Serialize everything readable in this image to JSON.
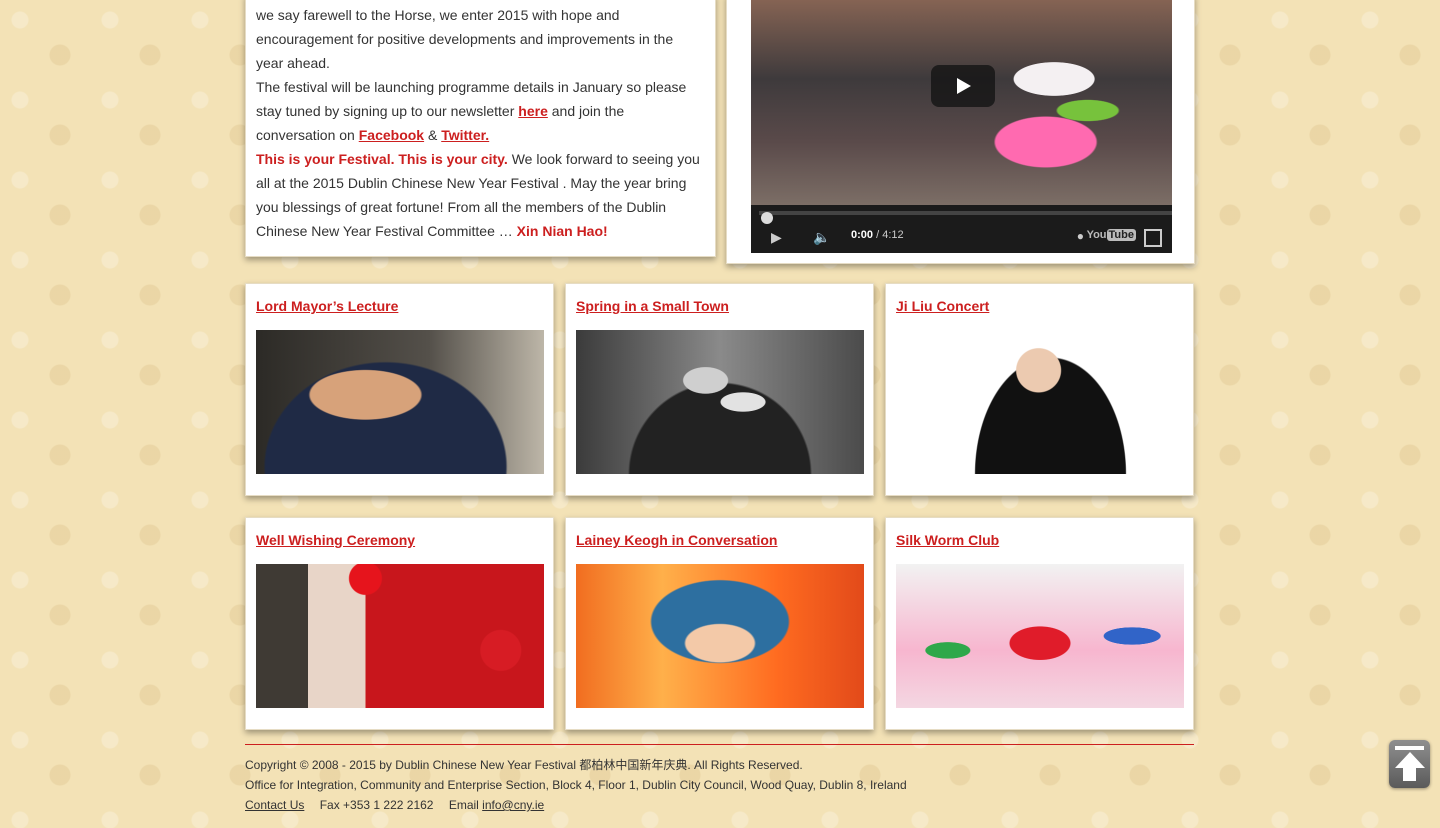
{
  "intro": {
    "line1": "we say farewell to the Horse, we enter 2015 with hope and",
    "line2": "encouragement for positive developments and improvements in the",
    "line3": "year ahead.",
    "line4": "The festival will be launching programme details in January so please",
    "line5_pre": "stay tuned by signing up to our newsletter ",
    "link_here": "here",
    "line5_post": " and join the",
    "line6_pre": "conversation on ",
    "link_facebook": "Facebook",
    "amp": " & ",
    "link_twitter": "Twitter.",
    "highlight": "This is your Festival. This is your city.",
    "line7_post": " We look forward to seeing you",
    "line8": "all at the 2015 Dublin Chinese New Year Festival . May the year bring",
    "line9": "you blessings of great fortune! From all the members of the Dublin",
    "line10_pre": "Chinese New Year Festival Committee … ",
    "greeting": "Xin Nian Hao!"
  },
  "video": {
    "time_current": "0:00",
    "time_total": " / 4:12",
    "brand": "You",
    "brand_box": "Tube",
    "progress": 0
  },
  "events": [
    {
      "title": "Lord Mayor’s Lecture"
    },
    {
      "title": "Spring in a Small Town"
    },
    {
      "title": "Ji Liu Concert"
    },
    {
      "title": "Well Wishing Ceremony"
    },
    {
      "title": "Lainey Keogh in Conversation"
    },
    {
      "title": "Silk Worm Club"
    }
  ],
  "footer": {
    "copyright": "Copyright © 2008 - 2015 by Dublin Chinese New Year Festival 都柏林中国新年庆典. All Rights Reserved.",
    "office": "Office for Integration, Community and Enterprise Section, Block 4, Floor 1, Dublin City Council, Wood Quay, Dublin 8, Ireland",
    "contact_label": "Contact Us",
    "fax": "Fax +353 1 222 2162",
    "email_label": "Email",
    "email": "info@cny.ie"
  }
}
